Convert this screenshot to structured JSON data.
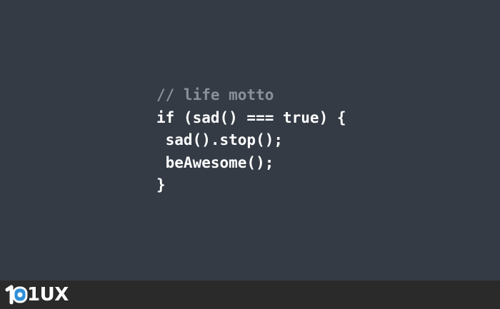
{
  "code": {
    "lines": [
      "// life motto",
      "if (sad() === true) {",
      " sad().stop();",
      " beAwesome();",
      "}"
    ]
  },
  "footer": {
    "logo_text": "1UX",
    "logo_icon": "rounded-square-logo-icon"
  },
  "colors": {
    "background": "#343b45",
    "footer_background": "#2a2a2a",
    "code_text": "#ffffff",
    "comment_text": "#8a9099",
    "logo_accent": "#2f8fd8"
  }
}
